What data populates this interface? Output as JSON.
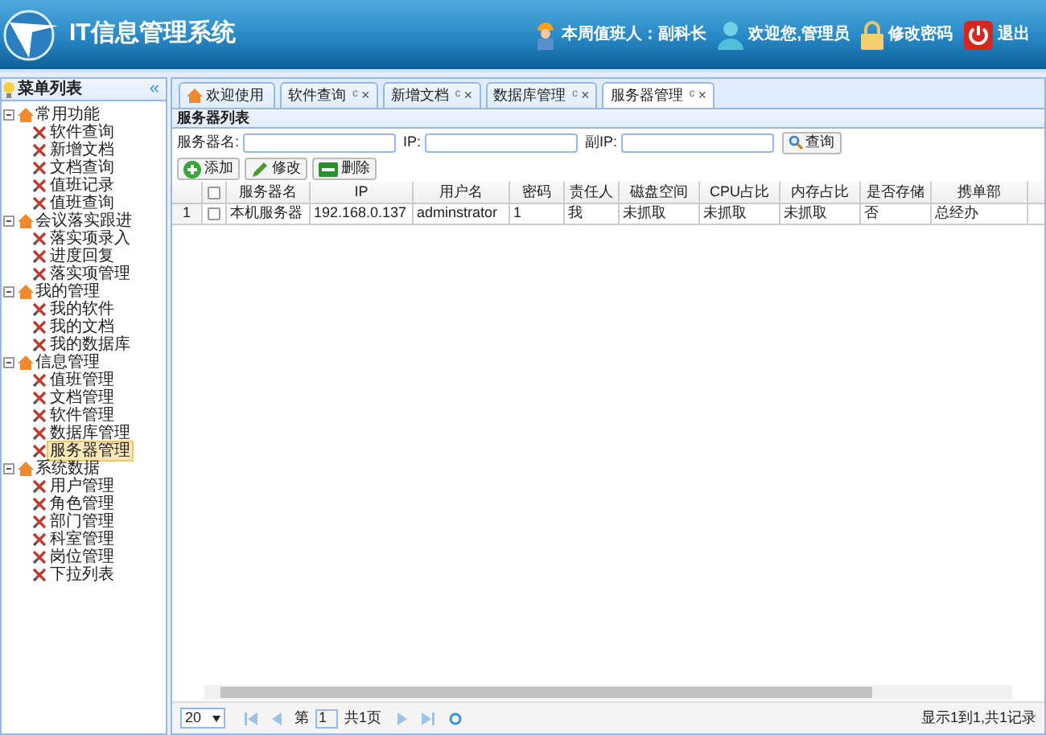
{
  "header": {
    "title": "IT信息管理系统",
    "duty_label": "本周值班人：副科长",
    "welcome": "欢迎您,管理员",
    "change_password": "修改密码",
    "logout": "退出"
  },
  "sidebar": {
    "title": "菜单列表",
    "collapse": "«",
    "items": [
      {
        "label": "常用功能",
        "expanded": true,
        "children": [
          {
            "label": "软件查询",
            "selected": false
          },
          {
            "label": "新增文档",
            "selected": false
          },
          {
            "label": "文档查询",
            "selected": false
          },
          {
            "label": "值班记录",
            "selected": false
          },
          {
            "label": "值班查询",
            "selected": false
          }
        ]
      },
      {
        "label": "会议落实跟进",
        "expanded": true,
        "children": [
          {
            "label": "落实项录入",
            "selected": false
          },
          {
            "label": "进度回复",
            "selected": false
          },
          {
            "label": "落实项管理",
            "selected": false
          }
        ]
      },
      {
        "label": "我的管理",
        "expanded": true,
        "children": [
          {
            "label": "我的软件",
            "selected": false
          },
          {
            "label": "我的文档",
            "selected": false
          },
          {
            "label": "我的数据库",
            "selected": false
          }
        ]
      },
      {
        "label": "信息管理",
        "expanded": true,
        "children": [
          {
            "label": "值班管理",
            "selected": false
          },
          {
            "label": "文档管理",
            "selected": false
          },
          {
            "label": "软件管理",
            "selected": false
          },
          {
            "label": "数据库管理",
            "selected": false
          },
          {
            "label": "服务器管理",
            "selected": true
          }
        ]
      },
      {
        "label": "系统数据",
        "expanded": true,
        "children": [
          {
            "label": "用户管理",
            "selected": false
          },
          {
            "label": "角色管理",
            "selected": false
          },
          {
            "label": "部门管理",
            "selected": false
          },
          {
            "label": "科室管理",
            "selected": false
          },
          {
            "label": "岗位管理",
            "selected": false
          },
          {
            "label": "下拉列表",
            "selected": false
          }
        ]
      }
    ]
  },
  "tabs": [
    {
      "label": "欢迎使用",
      "kind": "home",
      "selected": false
    },
    {
      "label": "软件查询",
      "kind": "closable",
      "refresh": "c",
      "close": "×",
      "selected": false
    },
    {
      "label": "新增文档",
      "kind": "closable",
      "refresh": "c",
      "close": "×",
      "selected": false
    },
    {
      "label": "数据库管理",
      "kind": "closable",
      "refresh": "c",
      "close": "×",
      "selected": false
    },
    {
      "label": "服务器管理",
      "kind": "closable",
      "refresh": "c",
      "close": "×",
      "selected": true
    }
  ],
  "panel": {
    "title": "服务器列表",
    "filters": [
      {
        "label": "服务器名:"
      },
      {
        "label": "IP:"
      },
      {
        "label": "副IP:"
      }
    ],
    "search_button": "查询",
    "actions": [
      {
        "label": "添加",
        "kind": "add"
      },
      {
        "label": "修改",
        "kind": "edit"
      },
      {
        "label": "删除",
        "kind": "delete"
      }
    ],
    "table": {
      "select_all_checked": false,
      "columns": [
        "服务器名",
        "IP",
        "用户名",
        "密码",
        "责任人",
        "磁盘空间",
        "CPU占比",
        "内存占比",
        "是否存储",
        "携单部"
      ],
      "rows": [
        {
          "number": "1",
          "checked": false,
          "cells": [
            "本机服务器",
            "192.168.0.137",
            "adminstrator",
            "1",
            "我",
            "未抓取",
            "未抓取",
            "未抓取",
            "否",
            "总经办"
          ]
        }
      ]
    },
    "pager": {
      "page_size": "20",
      "page_label": "第",
      "page": "1",
      "total_pages": "共1页",
      "summary": "显示1到1,共1记录"
    }
  }
}
